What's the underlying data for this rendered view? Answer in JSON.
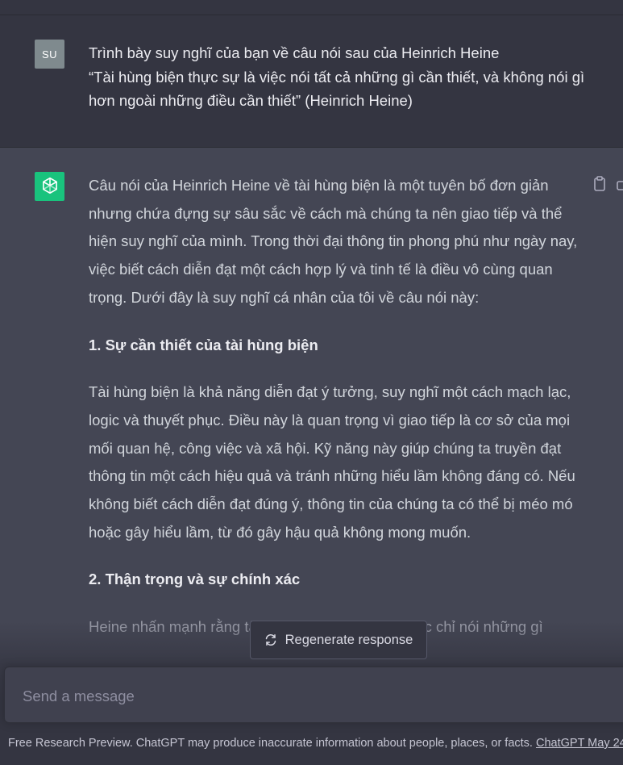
{
  "user_message": {
    "avatar_initials": "SU",
    "line1": "Trình bày suy nghĩ của bạn về câu nói sau của Heinrich Heine",
    "line2": "“Tài hùng biện thực sự là việc nói tất cả những gì cần thiết, và không nói gì hơn ngoài những điều cần thiết” (Heinrich Heine)"
  },
  "assistant_message": {
    "avatar_icon": "openai-logo-icon",
    "intro": "Câu nói của Heinrich Heine về tài hùng biện là một tuyên bố đơn giản nhưng chứa đựng sự sâu sắc về cách mà chúng ta nên giao tiếp và thể hiện suy nghĩ của mình. Trong thời đại thông tin phong phú như ngày nay, việc biết cách diễn đạt một cách hợp lý và tinh tế là điều vô cùng quan trọng. Dưới đây là suy nghĩ cá nhân của tôi về câu nói này:",
    "heading1": "1. Sự cần thiết của tài hùng biện",
    "para1": "Tài hùng biện là khả năng diễn đạt ý tưởng, suy nghĩ một cách mạch lạc, logic và thuyết phục. Điều này là quan trọng vì giao tiếp là cơ sở của mọi mối quan hệ, công việc và xã hội. Kỹ năng này giúp chúng ta truyền đạt thông tin một cách hiệu quả và tránh những hiểu lầm không đáng có. Nếu không biết cách diễn đạt đúng ý, thông tin của chúng ta có thể bị méo mó hoặc gây hiểu lầm, từ đó gây hậu quả không mong muốn.",
    "heading2": "2. Thận trọng và sự chính xác",
    "para2_partial": "Heine nhấn mạnh rằng tài hùng biện thực sự là việc chỉ nói những gì"
  },
  "regenerate": {
    "label": "Regenerate response",
    "icon": "refresh-icon"
  },
  "composer": {
    "placeholder": "Send a message"
  },
  "footer": {
    "text": "Free Research Preview. ChatGPT may produce inaccurate information about people, places, or facts. ",
    "link": "ChatGPT May 24"
  },
  "colors": {
    "background": "#343541",
    "assistant_background": "#444654",
    "openai_green": "#19c37d",
    "user_avatar": "#7f8a8e"
  }
}
